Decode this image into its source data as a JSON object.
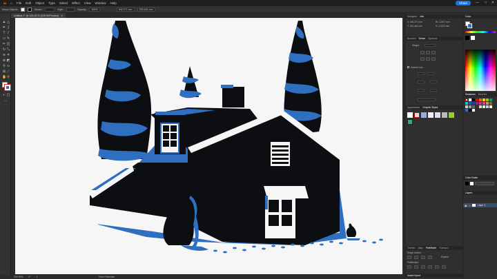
{
  "app": {
    "logo": "Ai",
    "menus": [
      "File",
      "Edit",
      "Object",
      "Type",
      "Select",
      "Effect",
      "View",
      "Window",
      "Help"
    ],
    "share_label": "Share",
    "window_controls": [
      "—",
      "□",
      "✕"
    ]
  },
  "control_bar": {
    "selection_label": "Mixed Objects",
    "stroke_label": "Stroke:",
    "style_label": "Style:",
    "opacity_label": "Opacity:",
    "opacity_value": "100%",
    "x_value": "406.271 mm",
    "y_value": "225.481 mm"
  },
  "document": {
    "tab_title": "Untitled-1* @ 100.25 % (CMYK/Preview)",
    "close_glyph": "✕"
  },
  "status_bar": {
    "zoom": "100.25%",
    "angle": "0°",
    "artboard": "1",
    "tool": "Direct Selection"
  },
  "panels": {
    "navigator_tabs": [
      "Navigator",
      "Info"
    ],
    "info_rows": [
      "X: 406.271 mm",
      "Y: 225.481 mm",
      "W: 2.2877 mm",
      "H: 2.2223 mm"
    ],
    "appearance_tabs": [
      "Brushes",
      "Stroke",
      "Symbols"
    ],
    "stroke_weight_label": "Weight:",
    "dashed_line_label": "Dashed Line",
    "graphic_tabs": [
      "Appearance",
      "Graphic Styles"
    ],
    "pathfinder_tabs": [
      "Transfo",
      "Align",
      "Pathfinder",
      "Transpa"
    ],
    "shape_modes_label": "Shape Modes:",
    "pathfinders_label": "Pathfinders:",
    "expand_label": "Expand",
    "asset_label": "Asset Export",
    "color_label": "Color",
    "swatches_tabs": [
      "Swatches",
      "Brushes"
    ],
    "color_guide_label": "Color Guide",
    "layers_label": "Layers",
    "layer_name": "Layer 1"
  },
  "colors": {
    "accent_blue": "#2f6fc0",
    "ink": "#0d0e12",
    "paper": "#f7f6f7",
    "share_blue": "#1473e6"
  }
}
